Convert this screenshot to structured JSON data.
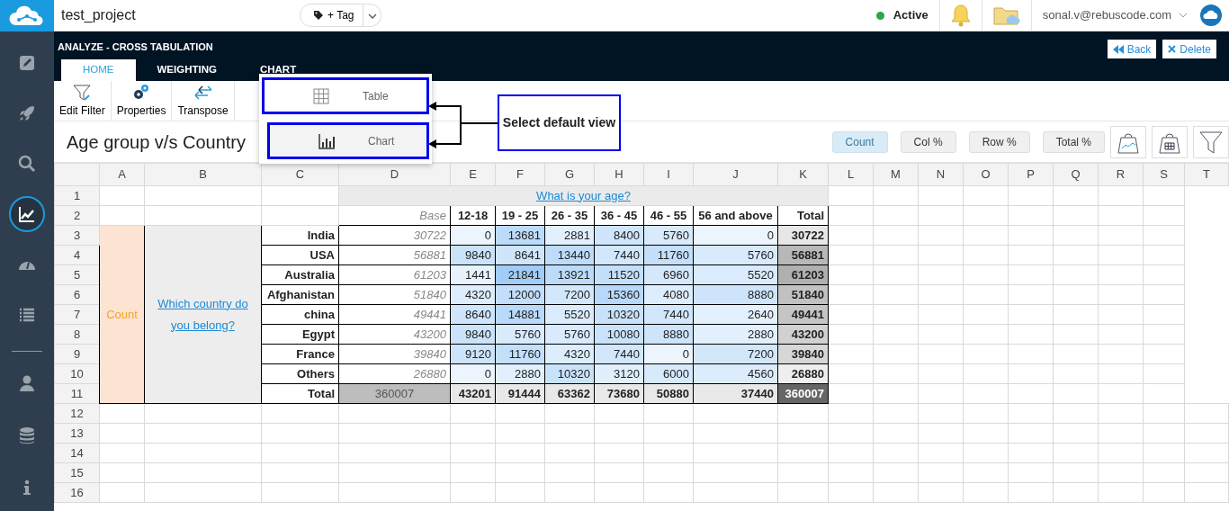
{
  "header": {
    "project": "test_project",
    "tag_button": "+ Tag",
    "status": "Active",
    "user": "sonal.v@rebuscode.com"
  },
  "sidebar": {
    "main": [
      {
        "kind": "edit",
        "selected": false
      },
      {
        "kind": "rocket",
        "selected": false
      },
      {
        "kind": "search",
        "selected": false
      },
      {
        "kind": "chart",
        "selected": true
      },
      {
        "kind": "gauge",
        "selected": false
      },
      {
        "kind": "list",
        "selected": false
      }
    ],
    "secondary": [
      {
        "kind": "user",
        "selected": false
      },
      {
        "kind": "database",
        "selected": false
      },
      {
        "kind": "info",
        "selected": false
      }
    ]
  },
  "page": {
    "title": "ANALYZE - CROSS TABULATION",
    "back": "Back",
    "delete": "Delete"
  },
  "tabs": [
    {
      "label": "HOME",
      "selected": true
    },
    {
      "label": "WEIGHTING",
      "selected": false
    },
    {
      "label": "CHART",
      "selected": false
    }
  ],
  "toolbar": [
    {
      "kind": "filter",
      "label": "Edit Filter"
    },
    {
      "kind": "properties",
      "label": "Properties"
    },
    {
      "kind": "transpose",
      "label": "Transpose"
    }
  ],
  "dropdown": [
    {
      "kind": "table",
      "label": "Table",
      "selected": false
    },
    {
      "kind": "chart",
      "label": "Chart",
      "selected": true
    }
  ],
  "callout": "Select default view",
  "report_title": "Age group v/s Country",
  "view_buttons": [
    {
      "label": "Count",
      "selected": true
    },
    {
      "label": "Col %",
      "selected": false
    },
    {
      "label": "Row %",
      "selected": false
    },
    {
      "label": "Total %",
      "selected": false
    }
  ],
  "tool_icons": [
    {
      "kind": "weight-chart"
    },
    {
      "kind": "weight-table"
    },
    {
      "kind": "filter"
    }
  ],
  "grid": {
    "columns": [
      "A",
      "B",
      "C",
      "D",
      "E",
      "F",
      "G",
      "H",
      "I",
      "J",
      "K",
      "L",
      "M",
      "N",
      "O",
      "P",
      "Q",
      "R",
      "S",
      "T"
    ],
    "rows": [
      "1",
      "2",
      "3",
      "4",
      "5",
      "6",
      "7",
      "8",
      "9",
      "10",
      "11",
      "12",
      "13",
      "14",
      "15",
      "16"
    ]
  },
  "crosstab": {
    "measure": "Count",
    "row_question": "Which country do you belong?",
    "column_question": "What is your age?",
    "base_label": "Base",
    "headers": [
      "12-18",
      "19 - 25",
      "26 - 35",
      "36 - 45",
      "46 - 55",
      "56 and above"
    ],
    "total_label": "Total",
    "rows": [
      {
        "label": "India",
        "base": "30722",
        "values": [
          "0",
          "13681",
          "2881",
          "8400",
          "5760",
          "0"
        ],
        "total": "30722"
      },
      {
        "label": "USA",
        "base": "56881",
        "values": [
          "9840",
          "8641",
          "13440",
          "7440",
          "11760",
          "5760"
        ],
        "total": "56881"
      },
      {
        "label": "Australia",
        "base": "61203",
        "values": [
          "1441",
          "21841",
          "13921",
          "11520",
          "6960",
          "5520"
        ],
        "total": "61203"
      },
      {
        "label": "Afghanistan",
        "base": "51840",
        "values": [
          "4320",
          "12000",
          "7200",
          "15360",
          "4080",
          "8880"
        ],
        "total": "51840"
      },
      {
        "label": "china",
        "base": "49441",
        "values": [
          "8640",
          "14881",
          "5520",
          "10320",
          "7440",
          "2640"
        ],
        "total": "49441"
      },
      {
        "label": "Egypt",
        "base": "43200",
        "values": [
          "9840",
          "5760",
          "5760",
          "10080",
          "8880",
          "2880"
        ],
        "total": "43200"
      },
      {
        "label": "France",
        "base": "39840",
        "values": [
          "9120",
          "11760",
          "4320",
          "7440",
          "0",
          "7200"
        ],
        "total": "39840"
      },
      {
        "label": "Others",
        "base": "26880",
        "values": [
          "0",
          "2880",
          "10320",
          "3120",
          "6000",
          "4560"
        ],
        "total": "26880"
      }
    ],
    "total_row": {
      "label": "Total",
      "base": "360007",
      "values": [
        "43201",
        "91444",
        "63362",
        "73680",
        "50880",
        "37440"
      ],
      "total": "360007"
    }
  }
}
